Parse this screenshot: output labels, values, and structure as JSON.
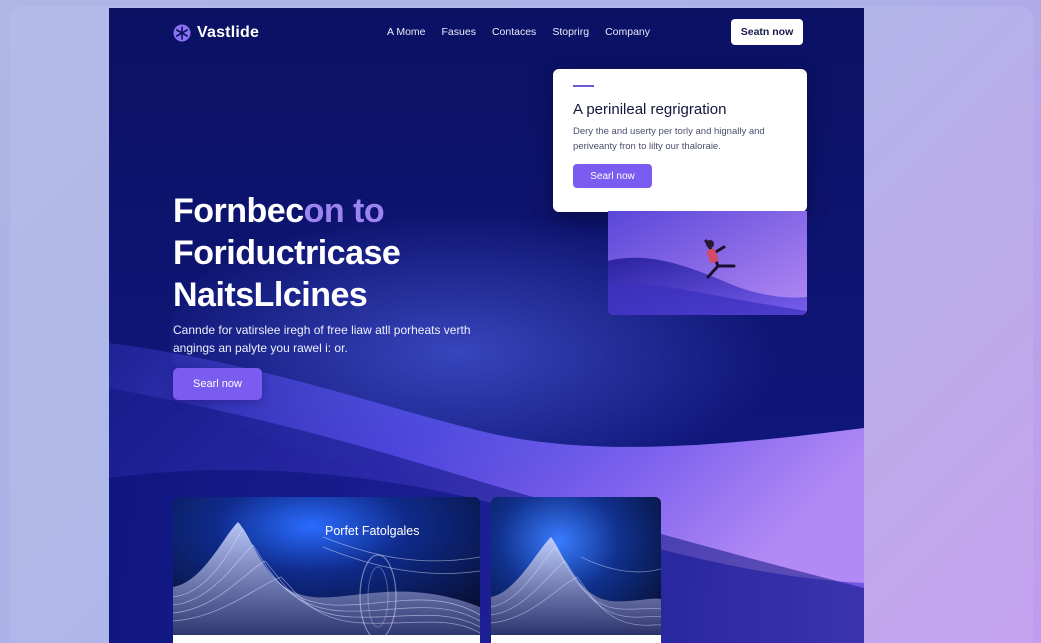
{
  "brand": {
    "name": "Vastlide",
    "accent": "#7b5cf0",
    "accent_light": "#9b84f2"
  },
  "nav": {
    "links": [
      "A Mome",
      "Fasues",
      "Contaces",
      "Stoprirg",
      "Company"
    ],
    "cta_label": "Seatn now"
  },
  "hero": {
    "title_line1_main": "Fornbec",
    "title_line1_accent": "on to",
    "title_line2": "Foriductricase",
    "title_line3": "NaitsLlcines",
    "subtitle": "Cannde for vatirslee iregh of free liaw atll porheats verth angings an palyte you rawel i: or.",
    "cta_label": "Searl now"
  },
  "card": {
    "title": "A perinileal regrigration",
    "body": "Dery the and userty per torly and hignally and periveanty fron to lilty our thaloraie.",
    "cta_label": "Searl now",
    "image_icon": "jumping-person-illustration"
  },
  "tiles": [
    {
      "label": "Porfet Fatolgales",
      "image_icon": "abstract-wave-render"
    },
    {
      "label": "",
      "image_icon": "abstract-wave-render"
    }
  ]
}
